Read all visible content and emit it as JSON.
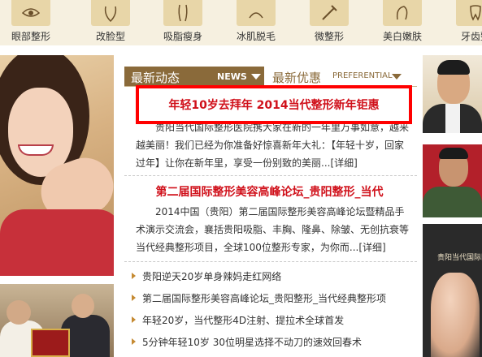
{
  "categories": [
    {
      "label": "眼部整形",
      "icon": "eye-icon"
    },
    {
      "label": "改脸型",
      "icon": "face-icon"
    },
    {
      "label": "吸脂瘦身",
      "icon": "body-icon"
    },
    {
      "label": "冰肌脱毛",
      "icon": "leg-icon"
    },
    {
      "label": "微整形",
      "icon": "injection-icon"
    },
    {
      "label": "美白嫩肤",
      "icon": "skin-icon"
    },
    {
      "label": "牙齿整",
      "icon": "tooth-icon"
    }
  ],
  "tabs": {
    "news": {
      "label": "最新动态",
      "label_en": "NEWS"
    },
    "promo": {
      "label": "最新优惠",
      "label_en": "PREFERENTIAL"
    }
  },
  "news": [
    {
      "title": "年轻10岁去拜年  2014当代整形新年钜惠",
      "summary": "贵阳当代国际整形医院携大家在新的一年里万事如意，越来越美丽！我们已经为你准备好惊喜新年大礼：【年轻十岁，回家过年】让你在新年里，享受一份别致的美丽...",
      "detail_label": "[详细]"
    },
    {
      "title": "第二届国际整形美容高峰论坛_贵阳整形_当代",
      "summary": "2014中国（贵阳）第二届国际整形美容高峰论坛暨精品手术演示交流会，襄括贵阳吸脂、丰胸、隆鼻、除皱、无创抗衰等当代经典整形项目，全球100位整形专家，为你而...",
      "detail_label": "[详细]"
    }
  ],
  "bullets": [
    "贵阳逆天20岁单身辣妈走红网络",
    "第二届国际整形美容高峰论坛_贵阳整形_当代经典整形项",
    "年轻20岁，当代整形4D注射、提拉术全球首发",
    "5分钟年轻10岁  30位明星选择不动刀的速效回春术"
  ],
  "right_column": {
    "doc3_label": "贵阳当代国际医"
  },
  "colors": {
    "accent_brown": "#8a6a3a",
    "headline_red": "#d0101a",
    "highlight_box": "#ff0000"
  }
}
